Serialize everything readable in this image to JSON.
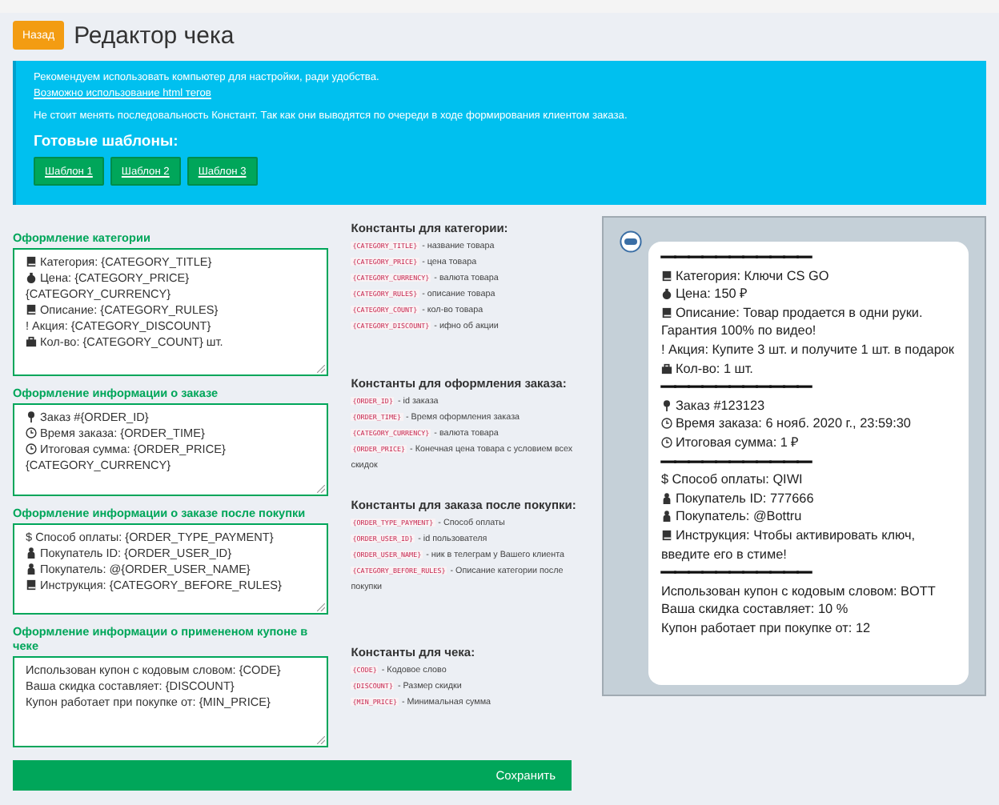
{
  "header": {
    "back_button": "Назад",
    "title": "Редактор чека"
  },
  "notice": {
    "lines": [
      "Рекомендуем использовать компьютер для настройки, ради удобства."
    ],
    "link": "Возможно использование html тегов",
    "warning": "Не стоит менять последовальность Констант. Так как они выводятся по очереди в ходе формирования клиентом заказа.",
    "templates_heading": "Готовые шаблоны:",
    "templates": [
      "Шаблон 1",
      "Шаблон 2",
      "Шаблон 3"
    ]
  },
  "sections": [
    {
      "label": "Оформление категории",
      "lines": [
        {
          "kind": "book",
          "text": "Категория: {CATEGORY_TITLE}"
        },
        {
          "kind": "bag",
          "text": "Цена: {CATEGORY_PRICE} {CATEGORY_CURRENCY}"
        },
        {
          "kind": "book",
          "text": "Описание: {CATEGORY_RULES}"
        },
        {
          "kind": "plain",
          "text": "! Акция:  {CATEGORY_DISCOUNT}"
        },
        {
          "kind": "case",
          "text": "Кол-во: {CATEGORY_COUNT} шт."
        }
      ]
    },
    {
      "label": "Оформление информации о заказе",
      "lines": [
        {
          "kind": "pin",
          "text": "Заказ #{ORDER_ID}"
        },
        {
          "kind": "clock",
          "text": "Время заказа: {ORDER_TIME}"
        },
        {
          "kind": "clock",
          "text": "Итоговая сумма: {ORDER_PRICE} {CATEGORY_CURRENCY}"
        }
      ]
    },
    {
      "label": "Оформление информации о заказе после покупки",
      "lines": [
        {
          "kind": "plain",
          "text": "$ Способ оплаты: {ORDER_TYPE_PAYMENT}"
        },
        {
          "kind": "person",
          "text": "Покупатель ID: {ORDER_USER_ID}"
        },
        {
          "kind": "person",
          "text": "Покупатель: @{ORDER_USER_NAME}"
        },
        {
          "kind": "book",
          "text": "Инструкция: {CATEGORY_BEFORE_RULES}"
        }
      ]
    },
    {
      "label": "Оформление информации о примененом купоне в чеке",
      "lines": [
        {
          "kind": "plain",
          "text": "Использован купон с кодовым словом: {CODE}"
        },
        {
          "kind": "plain",
          "text": "Ваша скидка составляет: {DISCOUNT}"
        },
        {
          "kind": "plain",
          "text": "Купон работает при покупке от: {MIN_PRICE}"
        }
      ]
    }
  ],
  "constants": [
    {
      "heading": "Константы для категории:",
      "items": [
        {
          "code": "{CATEGORY_TITLE}",
          "desc": "- название товара"
        },
        {
          "code": "{CATEGORY_PRICE}",
          "desc": "- цена товара"
        },
        {
          "code": "{CATEGORY_CURRENCY}",
          "desc": "- валюта товара"
        },
        {
          "code": "{CATEGORY_RULES}",
          "desc": "- описание товара"
        },
        {
          "code": "{CATEGORY_COUNT}",
          "desc": "- кол-во товара"
        },
        {
          "code": "{CATEGORY_DISCOUNT}",
          "desc": "- ифно об акции"
        }
      ]
    },
    {
      "heading": "Константы для оформления заказа:",
      "items": [
        {
          "code": "{ORDER_ID}",
          "desc": "- id заказа"
        },
        {
          "code": "{ORDER_TIME}",
          "desc": "- Время оформления заказа"
        },
        {
          "code": "{CATEGORY_CURRENCY}",
          "desc": "- валюта товара"
        },
        {
          "code": "{ORDER_PRICE}",
          "desc": "- Конечная цена товара с условием всех скидок"
        }
      ]
    },
    {
      "heading": "Константы для заказа после покупки:",
      "items": [
        {
          "code": "{ORDER_TYPE_PAYMENT}",
          "desc": "- Способ оплаты"
        },
        {
          "code": "{ORDER_USER_ID}",
          "desc": "- id пользователя"
        },
        {
          "code": "{ORDER_USER_NAME}",
          "desc": "- ник в телеграм у Вашего клиента"
        },
        {
          "code": "{CATEGORY_BEFORE_RULES}",
          "desc": "- Описание категории после покупки"
        }
      ]
    },
    {
      "heading": "Константы для чека:",
      "items": [
        {
          "code": "{CODE}",
          "desc": "- Кодовое слово"
        },
        {
          "code": "{DISCOUNT}",
          "desc": "- Размер скидки"
        },
        {
          "code": "{MIN_PRICE}",
          "desc": "- Минимальная сумма"
        }
      ]
    }
  ],
  "preview": {
    "lines": [
      {
        "kind": "sep",
        "text": "———————————"
      },
      {
        "kind": "book",
        "text": "Категория: Ключи CS GO"
      },
      {
        "kind": "bag",
        "text": "Цена: 150 ₽"
      },
      {
        "kind": "book",
        "text": "Описание: Товар продается в одни руки. Гарантия 100% по видео!"
      },
      {
        "kind": "plain",
        "text": "! Акция: Купите 3 шт. и получите 1 шт. в подарок"
      },
      {
        "kind": "case",
        "text": "Кол-во: 1 шт."
      },
      {
        "kind": "sep",
        "text": "———————————"
      },
      {
        "kind": "pin",
        "text": "Заказ #123123"
      },
      {
        "kind": "clock",
        "text": "Время заказа: 6 нояб. 2020 г., 23:59:30"
      },
      {
        "kind": "clock",
        "text": "Итоговая сумма: 1 ₽"
      },
      {
        "kind": "sep",
        "text": "———————————"
      },
      {
        "kind": "plain",
        "text": "$ Способ оплаты: QIWI"
      },
      {
        "kind": "person",
        "text": "Покупатель ID: 777666"
      },
      {
        "kind": "person",
        "text": "Покупатель: @Bottru"
      },
      {
        "kind": "book",
        "text": "Инструкция: Чтобы активировать ключ, введите его в стиме!"
      },
      {
        "kind": "sep",
        "text": "———————————"
      },
      {
        "kind": "plain",
        "text": "Использован купон с кодовым словом: BOTT"
      },
      {
        "kind": "plain",
        "text": "Ваша скидка составляет: 10 %"
      },
      {
        "kind": "plain",
        "text": "Купон работает при покупке от: 12"
      }
    ]
  },
  "save_button": "Сохранить"
}
